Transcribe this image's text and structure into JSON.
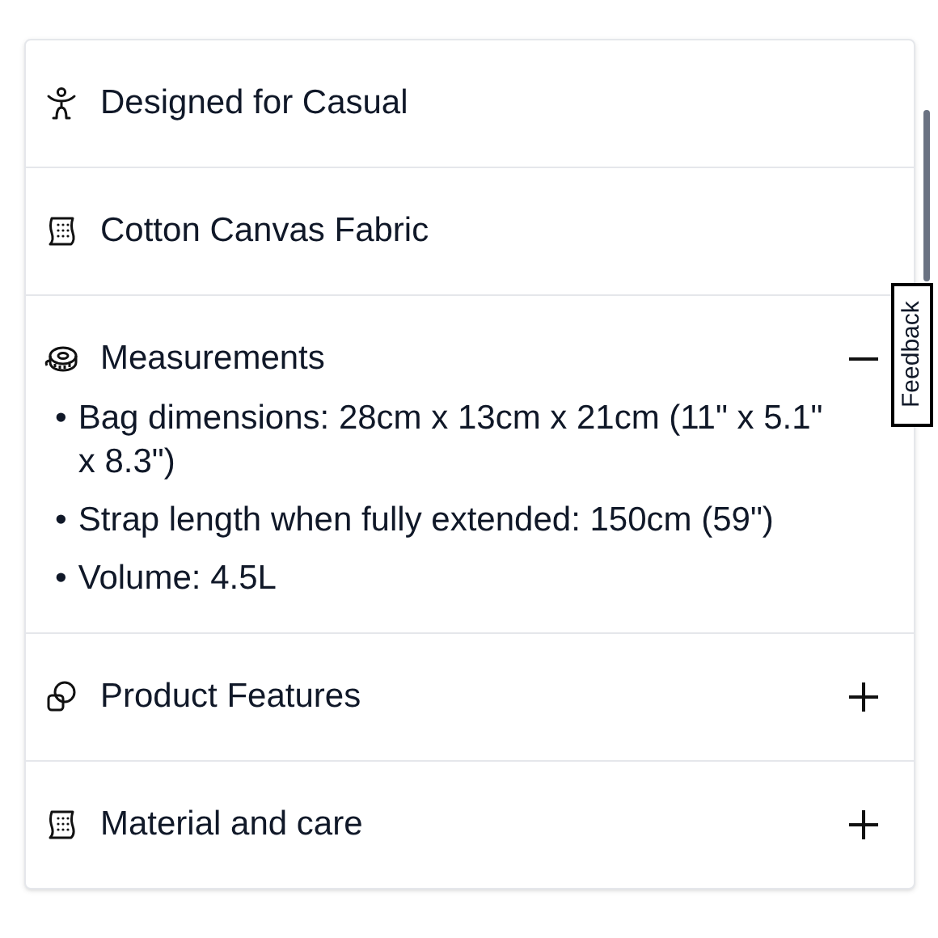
{
  "sections": [
    {
      "kind": "info",
      "title": "Designed for Casual"
    },
    {
      "kind": "info",
      "title": "Cotton Canvas Fabric"
    },
    {
      "kind": "accordion",
      "title": "Measurements",
      "expanded": true,
      "items": [
        {
          "bullet": "•",
          "text": "Bag dimensions: 28cm x 13cm x 21cm (11\" x 5.1\" x 8.3\")"
        },
        {
          "bullet": "•",
          "text": "Strap length when fully extended: 150cm (59\")"
        },
        {
          "bullet": "•",
          "text": "Volume: 4.5L"
        }
      ]
    },
    {
      "kind": "accordion",
      "title": "Product Features",
      "expanded": false
    },
    {
      "kind": "accordion",
      "title": "Material and care",
      "expanded": false
    }
  ],
  "feedback_tab": "Feedback"
}
